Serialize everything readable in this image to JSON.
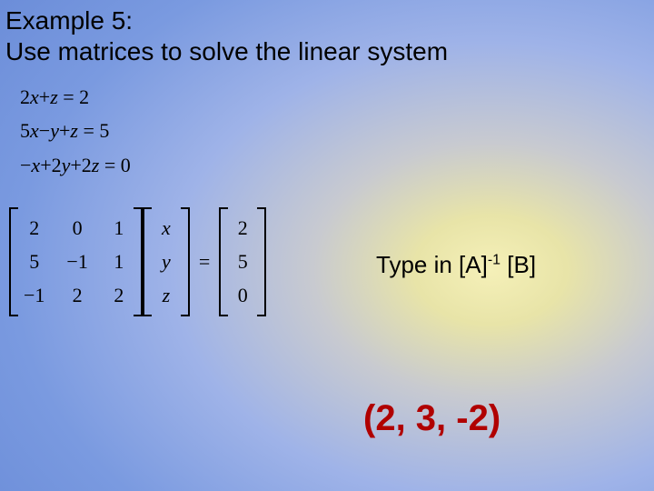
{
  "title": {
    "line1": "Example 5:",
    "line2": "Use matrices to solve the linear system"
  },
  "equations": {
    "eq1_lhs_a": "2",
    "eq1_lhs_b": "x",
    "eq1_lhs_c": "+",
    "eq1_lhs_d": "z",
    "eq1_lhs_e": "=",
    "eq1_lhs_f": "2",
    "eq2_lhs_a": "5",
    "eq2_lhs_b": "x",
    "eq2_lhs_c": "−",
    "eq2_lhs_d": "y",
    "eq2_lhs_e": "+",
    "eq2_lhs_f": "z",
    "eq2_lhs_g": "=",
    "eq2_lhs_h": "5",
    "eq3_lhs_a": "−",
    "eq3_lhs_b": "x",
    "eq3_lhs_c": "+",
    "eq3_lhs_d": "2",
    "eq3_lhs_e": "y",
    "eq3_lhs_f": "+",
    "eq3_lhs_g": "2",
    "eq3_lhs_h": "z",
    "eq3_lhs_i": "=",
    "eq3_lhs_j": "0"
  },
  "matrixA": {
    "r0c0": "2",
    "r0c1": "0",
    "r0c2": "1",
    "r1c0": "5",
    "r1c1": "−1",
    "r1c2": "1",
    "r2c0": "−1",
    "r2c1": "2",
    "r2c2": "2"
  },
  "vectorX": {
    "r0": "x",
    "r1": "y",
    "r2": "z"
  },
  "equals": "=",
  "vectorB": {
    "r0": "2",
    "r1": "5",
    "r2": "0"
  },
  "hint": {
    "prefix": "Type in [A]",
    "exp": "-1",
    "suffix": " [B]"
  },
  "answer": "(2, 3, -2)"
}
